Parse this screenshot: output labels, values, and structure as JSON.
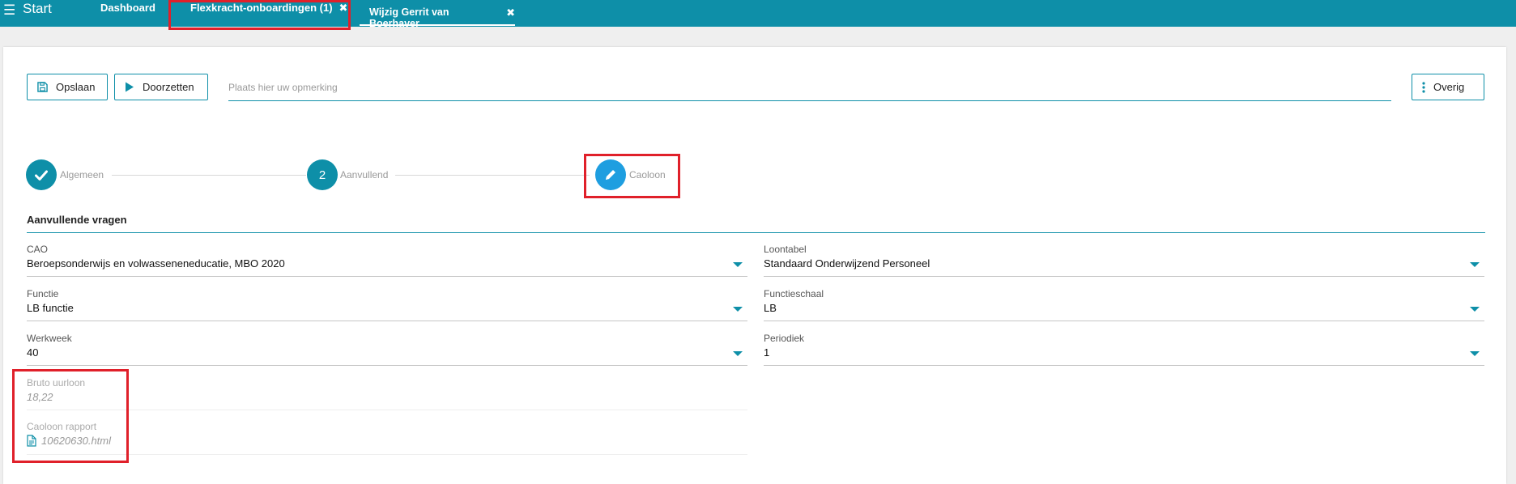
{
  "topbar": {
    "start_label": "Start",
    "hamburger_icon": "menu-icon",
    "tabs": [
      {
        "label": "Dashboard"
      },
      {
        "label": "Flexkracht-onboardingen (1)",
        "close_icon": "close-icon"
      },
      {
        "label": "Wijzig Gerrit van Boerhaver",
        "close_icon": "close-icon"
      }
    ]
  },
  "toolbar": {
    "save_label": "Opslaan",
    "forward_label": "Doorzetten",
    "remark_placeholder": "Plaats hier uw opmerking",
    "other_label": "Overig"
  },
  "steps": [
    {
      "label": "Algemeen",
      "state": "done"
    },
    {
      "number": "2",
      "label": "Aanvullend",
      "state": "done"
    },
    {
      "label": "Caoloon",
      "state": "active"
    }
  ],
  "section": {
    "title": "Aanvullende vragen"
  },
  "fields": {
    "cao": {
      "label": "CAO",
      "value": "Beroepsonderwijs en volwasseneneducatie, MBO 2020"
    },
    "loontabel": {
      "label": "Loontabel",
      "value": "Standaard Onderwijzend Personeel"
    },
    "functie": {
      "label": "Functie",
      "value": "LB functie"
    },
    "functieschaal": {
      "label": "Functieschaal",
      "value": "LB"
    },
    "werkweek": {
      "label": "Werkweek",
      "value": "40"
    },
    "periodiek": {
      "label": "Periodiek",
      "value": "1"
    },
    "bruto_uurloon": {
      "label": "Bruto uurloon",
      "value": "18,22"
    },
    "caoloon_rapport": {
      "label": "Caoloon rapport",
      "value": "10620630.html"
    }
  },
  "colors": {
    "accent": "#0e8fa8",
    "active_step": "#1e9ee0",
    "highlight": "#e0202a"
  }
}
